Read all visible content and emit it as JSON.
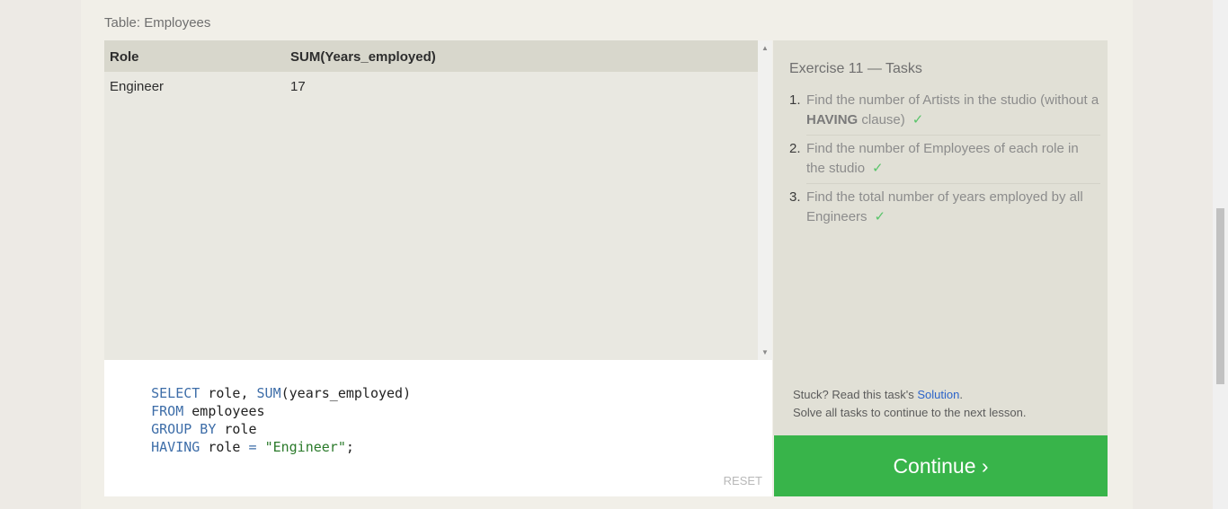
{
  "table": {
    "title": "Table: Employees",
    "columns": [
      "Role",
      "SUM(Years_employed)"
    ],
    "rows": [
      [
        "Engineer",
        "17"
      ]
    ]
  },
  "editor": {
    "lines": [
      [
        {
          "t": "SELECT",
          "k": true
        },
        {
          "t": " role, ",
          "k": false
        },
        {
          "t": "SUM",
          "k": true
        },
        {
          "t": "(years_employed)",
          "k": false
        }
      ],
      [
        {
          "t": "FROM",
          "k": true
        },
        {
          "t": " employees",
          "k": false
        }
      ],
      [
        {
          "t": "GROUP BY",
          "k": true
        },
        {
          "t": " role",
          "k": false
        }
      ],
      [
        {
          "t": "HAVING",
          "k": true
        },
        {
          "t": " role ",
          "k": false
        },
        {
          "t": "=",
          "k": true
        },
        {
          "t": " ",
          "k": false
        },
        {
          "t": "\"Engineer\"",
          "s": true
        },
        {
          "t": ";",
          "k": false
        }
      ]
    ],
    "reset_label": "RESET"
  },
  "tasks": {
    "title": "Exercise 11 — Tasks",
    "items": [
      {
        "num": "1.",
        "pre": "Find the number of Artists in the studio (without a ",
        "bold": "HAVING",
        "post": " clause)",
        "check": "✓"
      },
      {
        "num": "2.",
        "pre": "Find the number of Employees of each role in the studio",
        "bold": "",
        "post": "",
        "check": "✓"
      },
      {
        "num": "3.",
        "pre": "Find the total number of years employed by all Engineers",
        "bold": "",
        "post": "",
        "check": "✓"
      }
    ],
    "stuck_prefix": "Stuck? Read this task's ",
    "solution_link": "Solution",
    "stuck_suffix": ".",
    "solve_all": "Solve all tasks to continue to the next lesson."
  },
  "continue_label": "Continue ›",
  "colors": {
    "accent": "#38b44a",
    "link": "#2c64c9",
    "check": "#59c46a"
  }
}
